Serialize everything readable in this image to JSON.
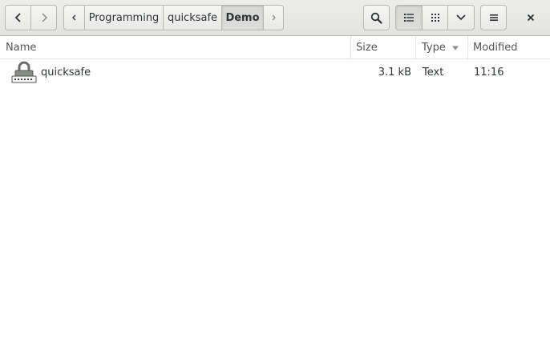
{
  "path_bar": {
    "crumbs": [
      "Programming",
      "quicksafe",
      "Demo"
    ]
  },
  "columns": {
    "name": "Name",
    "size": "Size",
    "type": "Type",
    "modified": "Modified"
  },
  "files": [
    {
      "name": "quicksafe",
      "size": "3.1 kB",
      "type": "Text",
      "modified": "11:16",
      "icon": "lock-file-icon"
    }
  ],
  "icons": [
    "back-icon",
    "forward-icon",
    "scroll-left-icon",
    "scroll-right-icon",
    "search-icon",
    "list-view-icon",
    "grid-view-icon",
    "chevron-down-icon",
    "menu-icon",
    "close-icon",
    "sort-down-icon",
    "lock-file-icon"
  ],
  "colors": {
    "active_button": "#d8d8d5",
    "headerbar": "#e8e8e7"
  }
}
